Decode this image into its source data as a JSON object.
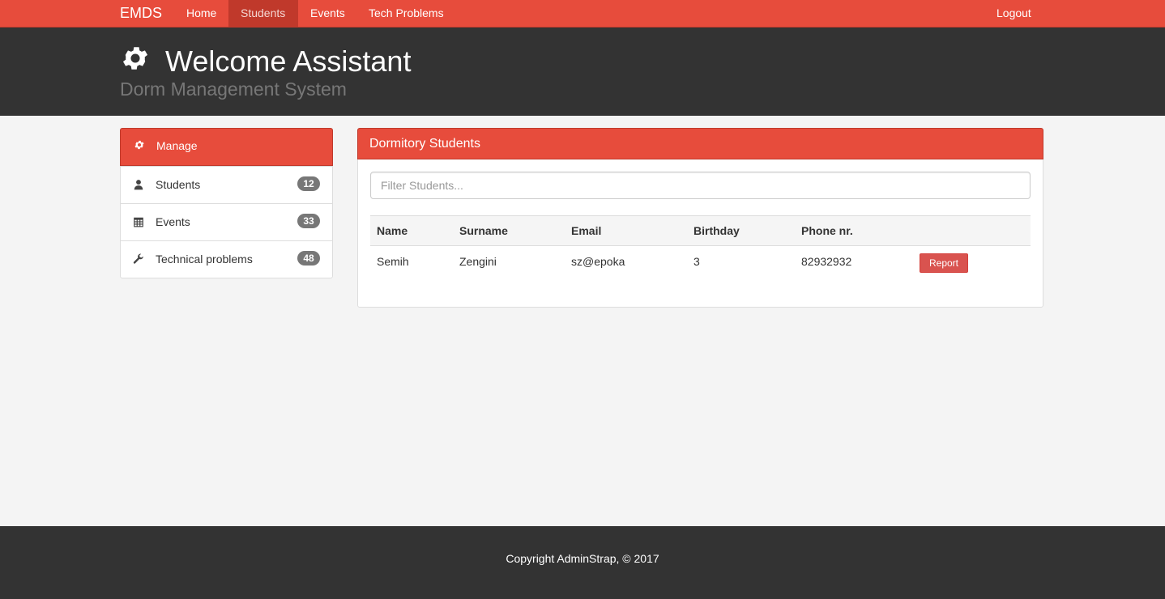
{
  "nav": {
    "brand": "EMDS",
    "items": [
      {
        "label": "Home",
        "active": false
      },
      {
        "label": "Students",
        "active": true
      },
      {
        "label": "Events",
        "active": false
      },
      {
        "label": "Tech Problems",
        "active": false
      }
    ],
    "logout": "Logout"
  },
  "header": {
    "icon": "gear-icon",
    "title": "Welcome Assistant",
    "subtitle": "Dorm Management System"
  },
  "sidebar": {
    "items": [
      {
        "label": "Manage",
        "icon": "gear-icon",
        "active": true
      },
      {
        "label": "Students",
        "icon": "user-icon",
        "count": "12"
      },
      {
        "label": "Events",
        "icon": "calendar-icon",
        "count": "33"
      },
      {
        "label": "Technical problems",
        "icon": "wrench-icon",
        "count": "48"
      }
    ]
  },
  "panel": {
    "title": "Dormitory Students",
    "filter_placeholder": "Filter Students...",
    "filter_value": "",
    "columns": [
      "Name",
      "Surname",
      "Email",
      "Birthday",
      "Phone nr."
    ],
    "rows": [
      {
        "name": "Semih",
        "surname": "Zengini",
        "email": "sz@epoka",
        "birthday": "3",
        "phone": "82932932",
        "action": "Report"
      }
    ]
  },
  "footer": {
    "text": "Copyright AdminStrap, © 2017"
  },
  "colors": {
    "accent": "#e74c3c",
    "accent_dark": "#c0392b",
    "header_bg": "#333333",
    "danger_button": "#d9534f",
    "badge": "#777777"
  }
}
